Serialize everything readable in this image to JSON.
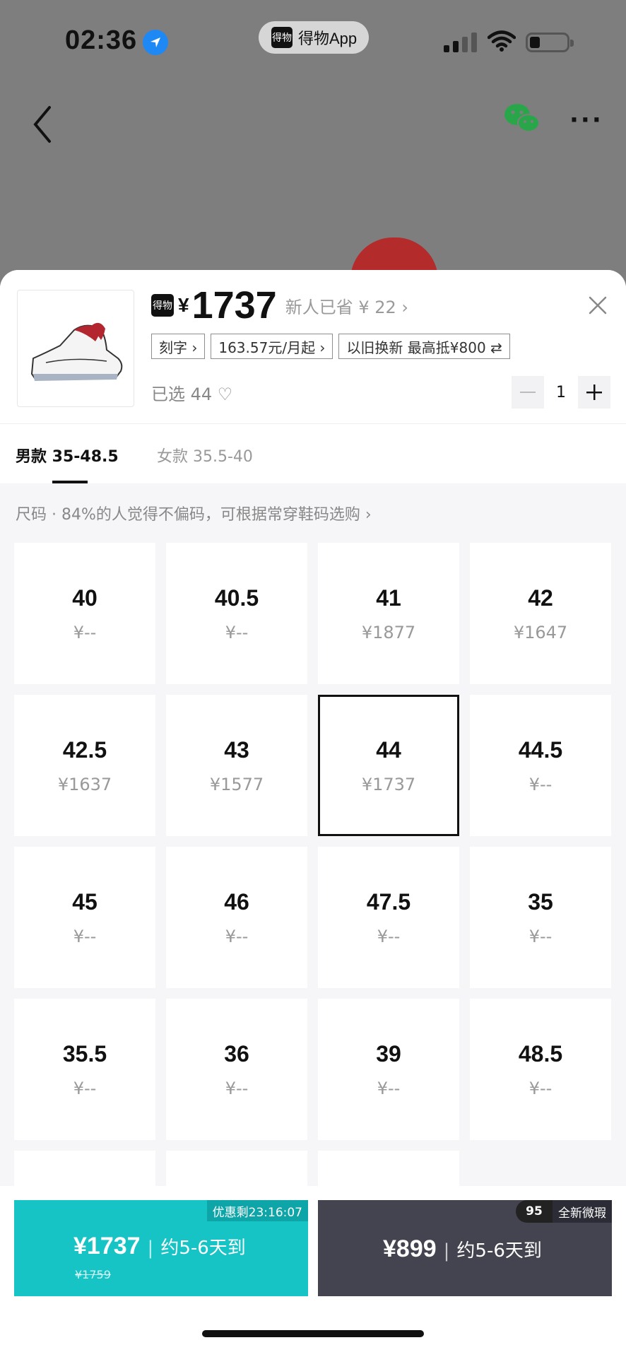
{
  "status": {
    "time": "02:36",
    "app_name": "得物App",
    "app_logo": "得物",
    "battery_level": 0.2
  },
  "nav": {
    "back_icon": "chevron-left-icon",
    "share_icon": "wechat-icon",
    "more_label": "···"
  },
  "product": {
    "brand_logo": "得物",
    "currency": "¥",
    "price": "1737",
    "saving": "新人已省 ¥ 22 ›",
    "tags": [
      "刻字 ›",
      "163.57元/月起 ›",
      "以旧换新 最高抵¥800 ⇄"
    ],
    "selected": "已选 44 ♡",
    "quantity": "1",
    "close_icon": "close-icon"
  },
  "tabs": {
    "men": "男款 35-48.5",
    "women": "女款 35.5-40"
  },
  "size_hint": "尺码 · 84%的人觉得不偏码，可根据常穿鞋码选购 ›",
  "sizes": [
    {
      "size": "40",
      "price": "¥--"
    },
    {
      "size": "40.5",
      "price": "¥--"
    },
    {
      "size": "41",
      "price": "¥1877"
    },
    {
      "size": "42",
      "price": "¥1647"
    },
    {
      "size": "42.5",
      "price": "¥1637"
    },
    {
      "size": "43",
      "price": "¥1577"
    },
    {
      "size": "44",
      "price": "¥1737",
      "selected": true
    },
    {
      "size": "44.5",
      "price": "¥--"
    },
    {
      "size": "45",
      "price": "¥--"
    },
    {
      "size": "46",
      "price": "¥--"
    },
    {
      "size": "47.5",
      "price": "¥--"
    },
    {
      "size": "35",
      "price": "¥--"
    },
    {
      "size": "35.5",
      "price": "¥--"
    },
    {
      "size": "36",
      "price": "¥--"
    },
    {
      "size": "39",
      "price": "¥--"
    },
    {
      "size": "48.5",
      "price": "¥--"
    }
  ],
  "buy": {
    "badge": "优惠剩23:16:07",
    "price": "¥1737",
    "divider": "|",
    "eta": "约5-6天到",
    "original": "¥1759"
  },
  "alt": {
    "badge_logo": "95",
    "badge_text": "全新微瑕",
    "price": "¥899",
    "divider": "|",
    "eta": "约5-6天到"
  },
  "colors": {
    "buy_accent": "#16c3c5",
    "alt_bg": "#43444f",
    "selected_border": "#111111"
  }
}
